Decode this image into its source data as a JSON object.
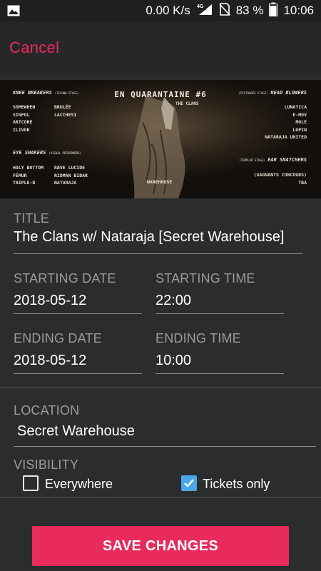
{
  "status": {
    "speed": "0.00 K/s",
    "network": "4G",
    "battery": "83 %",
    "time": "10:06"
  },
  "appbar": {
    "cancel_label": "Cancel"
  },
  "poster": {
    "title": "EN QUARANTAINE #6",
    "subtitle": "THE CLANS",
    "group1_head": "KNEE BREAKERS",
    "group1_tag": "(TECHNO STAGE)",
    "group1_col1": [
      "SOMEWHEN",
      "SINFOL",
      "ARTCORE",
      "ILIVOR"
    ],
    "group1_col2": [
      "BRULÉE",
      "LACCHESI"
    ],
    "group2_head": "EYE SHAKERS",
    "group2_tag": "(VISUAL PERFORMERS)",
    "group2_col1": [
      "HOLY BOTTOM",
      "FÉMUR",
      "TRIPLE-D"
    ],
    "group2_col2": [
      "RÆVE LUCIDE",
      "RIDMAN BIDAR",
      "NATARAJA"
    ],
    "group3_head": "HEAD BLOWERS",
    "group3_tag": "(PSYTRANCE STAGE)",
    "group3_list": [
      "LUNATICA",
      "E-MOV",
      "MOLE",
      "LUPIN",
      "NATARAJA UNITED"
    ],
    "group4_head": "EAR SNATCHERS",
    "group4_tag": "(TEMPLAR STAGE)",
    "group4_list": [
      "(GAGNANTS CONCOURS)",
      "TBA"
    ],
    "venue": "WAREHOUSE"
  },
  "form": {
    "title_label": "TITLE",
    "title_value": "The Clans w/ Nataraja [Secret Warehouse]",
    "start_date_label": "STARTING DATE",
    "start_date_value": "2018-05-12",
    "start_time_label": "STARTING TIME",
    "start_time_value": "22:00",
    "end_date_label": "ENDING DATE",
    "end_date_value": "2018-05-12",
    "end_time_label": "ENDING TIME",
    "end_time_value": "10:00",
    "location_label": "LOCATION",
    "location_value": "Secret Warehouse",
    "visibility_label": "VISIBILITY",
    "visibility_options": [
      {
        "label": "Everywhere",
        "checked": false
      },
      {
        "label": "Tickets only",
        "checked": true
      }
    ]
  },
  "save_label": "SAVE CHANGES",
  "colors": {
    "accent": "#e82b5b",
    "check": "#4aa8e8",
    "background": "#2b2c2e"
  }
}
